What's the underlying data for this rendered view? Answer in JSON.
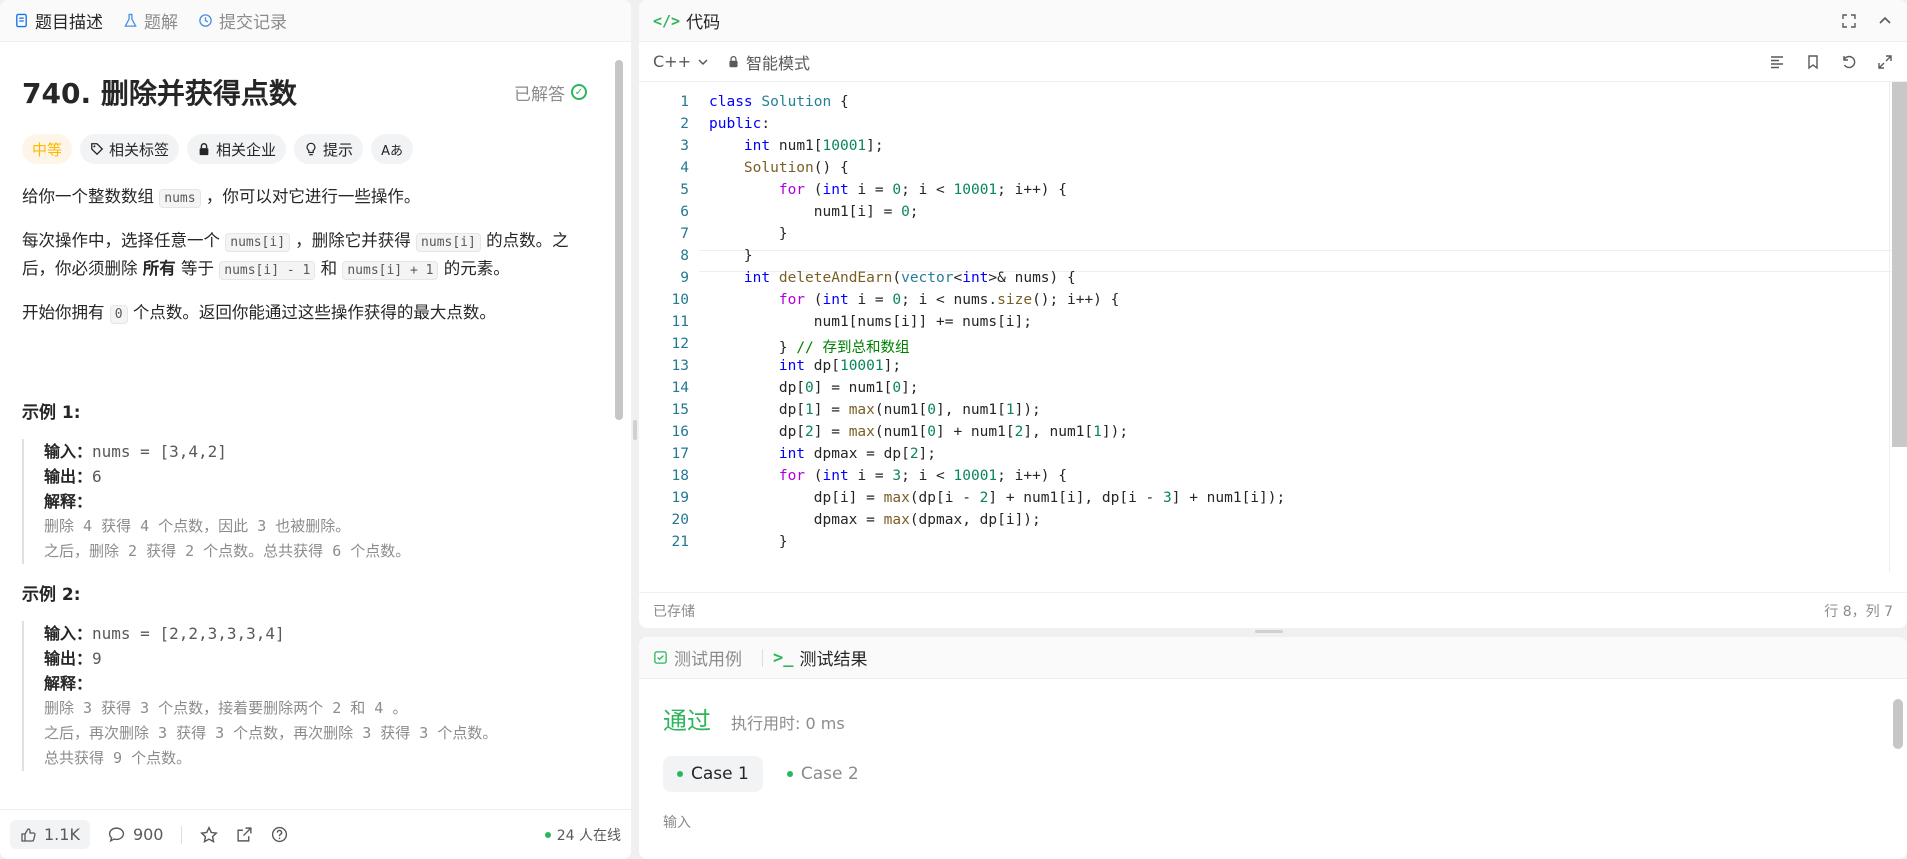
{
  "left": {
    "tabs": [
      {
        "label": "题目描述"
      },
      {
        "label": "题解"
      },
      {
        "label": "提交记录"
      }
    ],
    "title": "740. 删除并获得点数",
    "solved_label": "已解答",
    "tags": {
      "difficulty": "中等",
      "related_tags": "相关标签",
      "related_companies": "相关企业",
      "hint": "提示",
      "translate": "Aあ"
    },
    "desc": {
      "p1_a": "给你一个整数数组",
      "p1_code": "nums",
      "p1_b": "，你可以对它进行一些操作。",
      "p2_a": "每次操作中，选择任意一个",
      "p2_code1": "nums[i]",
      "p2_b": "，删除它并获得",
      "p2_code2": "nums[i]",
      "p2_c": "的点数。之后，你必须删除",
      "p2_bold": "所有",
      "p2_d": "等于",
      "p2_code3": "nums[i] - 1",
      "p2_e": "和",
      "p2_code4": "nums[i] + 1",
      "p2_f": "的元素。",
      "p3_a": "开始你拥有",
      "p3_code": "0",
      "p3_b": "个点数。返回你能通过这些操作获得的最大点数。"
    },
    "examples": [
      {
        "title": "示例 1:",
        "input_k": "输入：",
        "input_v": "nums = [3,4,2]",
        "output_k": "输出：",
        "output_v": "6",
        "explain_k": "解释：",
        "lines": [
          "删除 4 获得 4 个点数，因此 3 也被删除。",
          "之后，删除 2 获得 2 个点数。总共获得 6 个点数。"
        ]
      },
      {
        "title": "示例 2:",
        "input_k": "输入：",
        "input_v": "nums = [2,2,3,3,3,4]",
        "output_k": "输出：",
        "output_v": "9",
        "explain_k": "解释：",
        "lines": [
          "删除 3 获得 3 个点数，接着要删除两个 2 和 4 。",
          "之后，再次删除 3 获得 3 个点数，再次删除 3 获得 3 个点数。",
          "总共获得 9 个点数。"
        ]
      }
    ],
    "footer": {
      "likes": "1.1K",
      "comments": "900",
      "online": "24 人在线"
    }
  },
  "code": {
    "tab_label": "代码",
    "language": "C++",
    "mode": "智能模式",
    "status_saved": "已存储",
    "cursor_pos": "行 8，列 7",
    "line_numbers": [
      "1",
      "2",
      "3",
      "4",
      "5",
      "6",
      "7",
      "8",
      "9",
      "10",
      "11",
      "12",
      "13",
      "14",
      "15",
      "16",
      "17",
      "18",
      "19",
      "20",
      "21"
    ]
  },
  "test": {
    "tab_cases": "测试用例",
    "tab_results": "测试结果",
    "result": "通过",
    "runtime": "执行用时: 0 ms",
    "cases": [
      "Case 1",
      "Case 2"
    ],
    "input_label": "输入"
  },
  "colors": {
    "accent_green": "#2db55d",
    "medium_orange": "#ffb800"
  }
}
